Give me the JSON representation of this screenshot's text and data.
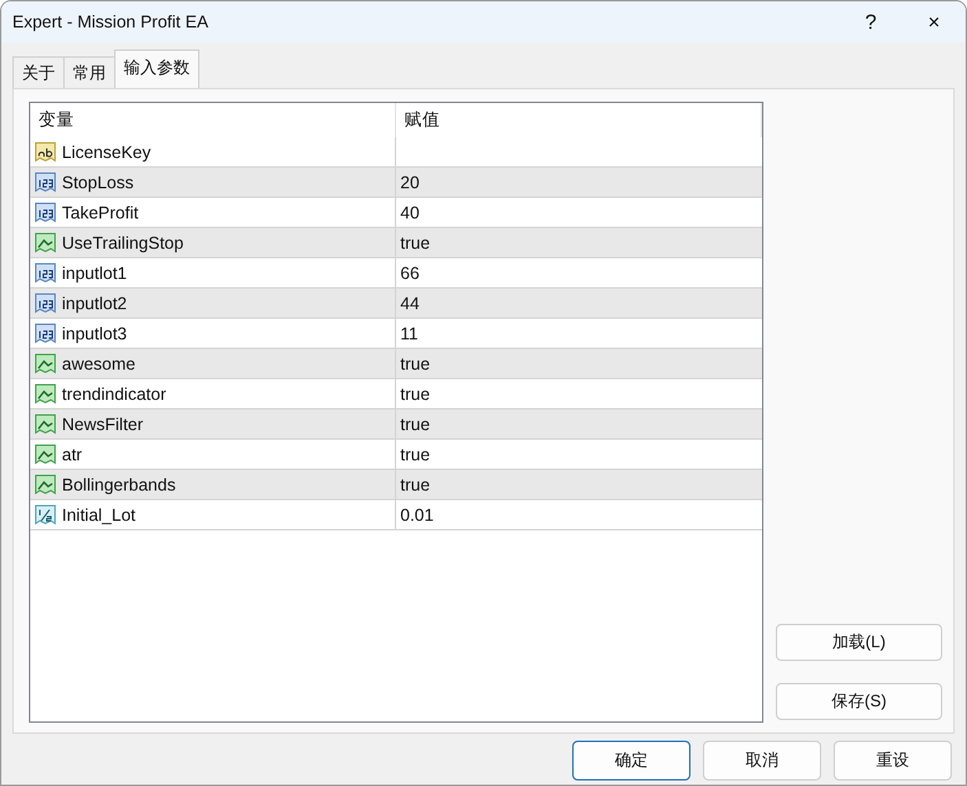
{
  "window": {
    "title": "Expert - Mission Profit EA",
    "help": "?",
    "close": "×"
  },
  "tabs": [
    {
      "label": "关于",
      "selected": false
    },
    {
      "label": "常用",
      "selected": false
    },
    {
      "label": "输入参数",
      "selected": true
    }
  ],
  "table": {
    "columns": [
      "变量",
      "赋值"
    ],
    "rows": [
      {
        "kind": "string",
        "name": "LicenseKey"
      },
      {
        "kind": "int",
        "name": "StopLoss",
        "value": "20"
      },
      {
        "kind": "int",
        "name": "TakeProfit",
        "value": "40"
      },
      {
        "kind": "bool",
        "name": "UseTrailingStop",
        "value": "true"
      },
      {
        "kind": "int",
        "name": "inputlot1",
        "value": "66"
      },
      {
        "kind": "int",
        "name": "inputlot2",
        "value": "44"
      },
      {
        "kind": "int",
        "name": "inputlot3",
        "value": "11"
      },
      {
        "kind": "bool",
        "name": "awesome",
        "value": "true"
      },
      {
        "kind": "bool",
        "name": "trendindicator",
        "value": "true"
      },
      {
        "kind": "bool",
        "name": "NewsFilter",
        "value": "true"
      },
      {
        "kind": "bool",
        "name": "atr",
        "value": "true"
      },
      {
        "kind": "bool",
        "name": "Bollingerbands",
        "value": "true"
      },
      {
        "kind": "double",
        "name": "Initial_Lot",
        "value": "0.01"
      }
    ]
  },
  "side_buttons": [
    "加载(L)",
    "保存(S)"
  ],
  "buttons": [
    {
      "label": "确定",
      "selected": true
    },
    {
      "label": "取消",
      "selected": false
    },
    {
      "label": "重设",
      "selected": false
    }
  ]
}
